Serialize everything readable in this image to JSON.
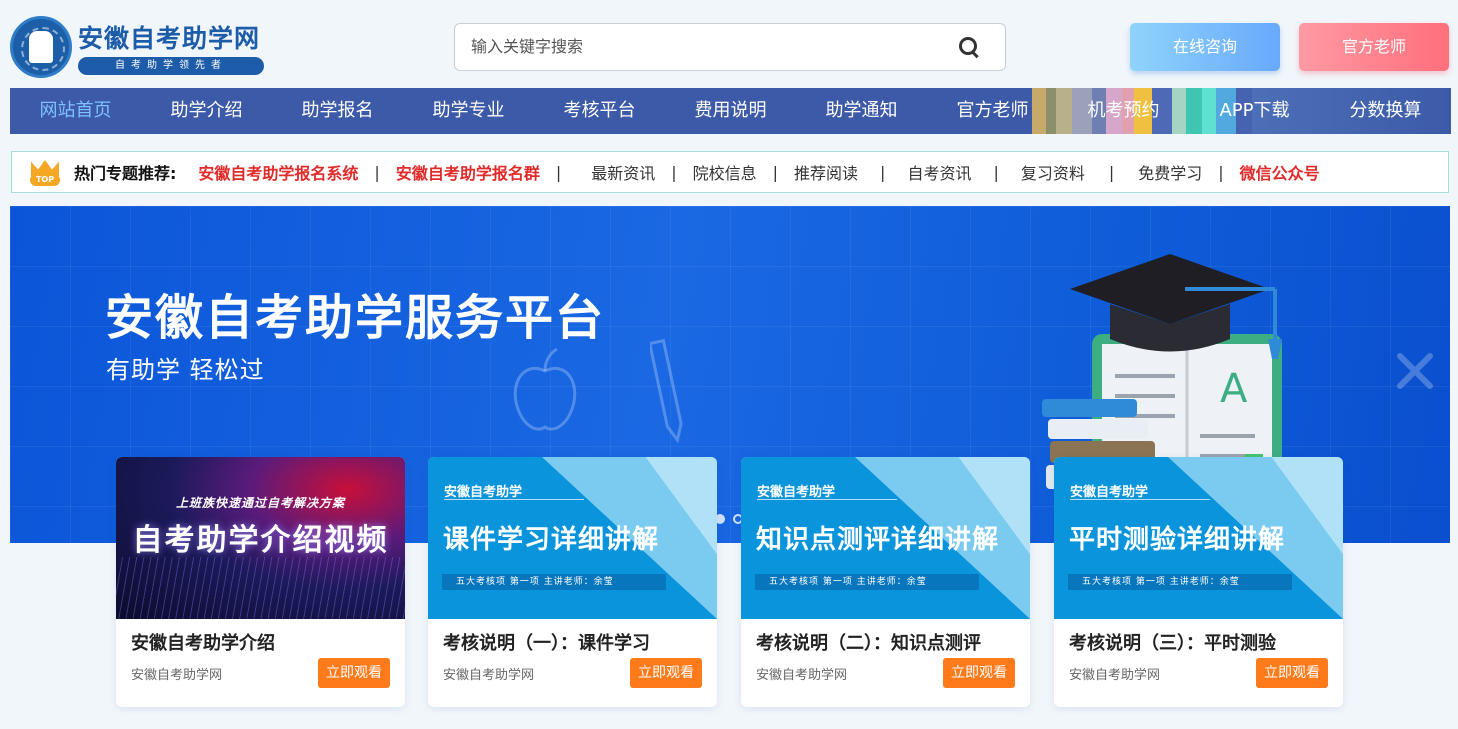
{
  "header": {
    "logo_title": "安徽自考助学网",
    "logo_slogan": "自考助学领先者",
    "search_placeholder": "输入关键字搜索",
    "consult_button": "在线咨询",
    "teacher_button": "官方老师"
  },
  "nav": {
    "items": [
      "网站首页",
      "助学介绍",
      "助学报名",
      "助学专业",
      "考核平台",
      "费用说明",
      "助学通知",
      "官方老师",
      "机考预约",
      "APP下载",
      "分数换算"
    ],
    "active_index": 0
  },
  "hotbar": {
    "badge": "TOP",
    "title": "热门专题推荐:",
    "links": [
      {
        "label": "安徽自考助学报名系统",
        "red": true
      },
      {
        "label": "安徽自考助学报名群",
        "red": true
      },
      {
        "label": "最新资讯",
        "red": false
      },
      {
        "label": "院校信息",
        "red": false
      },
      {
        "label": "推荐阅读",
        "red": false
      },
      {
        "label": "自考资讯",
        "red": false
      },
      {
        "label": "复习资料",
        "red": false
      },
      {
        "label": "免费学习",
        "red": false
      },
      {
        "label": "微信公众号",
        "red": true
      }
    ]
  },
  "banner": {
    "title": "安徽自考助学服务平台",
    "subtitle": "有助学  轻松过",
    "art_letter": "A"
  },
  "cards": [
    {
      "thumb_type": "video",
      "thumb_top": "上班族快速通过自考解决方案",
      "thumb_big": "自考助学介绍视频",
      "title": "安徽自考助学介绍",
      "source": "安徽自考助学网",
      "button": "立即观看"
    },
    {
      "thumb_type": "blue",
      "thumb_brand": "安徽自考助学",
      "thumb_big": "课件学习详细讲解",
      "thumb_strip": "五大考核项  第一项   主讲老师：余莹",
      "title": "考核说明（一）：课件学习",
      "source": "安徽自考助学网",
      "button": "立即观看"
    },
    {
      "thumb_type": "blue",
      "thumb_brand": "安徽自考助学",
      "thumb_big": "知识点测评详细讲解",
      "thumb_strip": "五大考核项  第一项   主讲老师：余莹",
      "title": "考核说明（二）：知识点测评",
      "source": "安徽自考助学网",
      "button": "立即观看"
    },
    {
      "thumb_type": "blue",
      "thumb_brand": "安徽自考助学",
      "thumb_big": "平时测验详细讲解",
      "thumb_strip": "五大考核项  第一项   主讲老师：余莹",
      "title": "考核说明（三）：平时测验",
      "source": "安徽自考助学网",
      "button": "立即观看"
    }
  ],
  "colors": {
    "brand_blue": "#1d5ca8",
    "nav_bg": "#3c5aa8",
    "nav_active": "#7fc2ff",
    "hot_red": "#e02b2b",
    "watch_orange": "#ff7a1a"
  }
}
